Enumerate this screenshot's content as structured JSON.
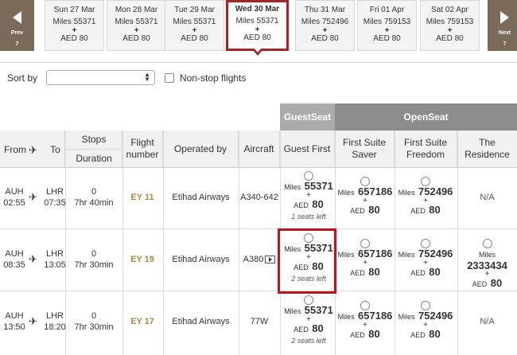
{
  "nav": {
    "prev_label": "Prev",
    "prev_num": "7",
    "next_label": "Next",
    "next_num": "7"
  },
  "dates": [
    {
      "date": "Sun 27 Mar",
      "miles": "Miles 55371",
      "plus": "+",
      "aed": "AED 80"
    },
    {
      "date": "Mon 28 Mar",
      "miles": "Miles 55371",
      "plus": "+",
      "aed": "AED 80"
    },
    {
      "date": "Tue 29 Mar",
      "miles": "Miles 55371",
      "plus": "+",
      "aed": "AED 80"
    },
    {
      "date": "Wed 30 Mar",
      "miles": "Miles 55371",
      "plus": "+",
      "aed": "AED 80"
    },
    {
      "date": "Thu 31 Mar",
      "miles": "Miles 752496",
      "plus": "+",
      "aed": "AED 80"
    },
    {
      "date": "Fri 01 Apr",
      "miles": "Miles 759153",
      "plus": "+",
      "aed": "AED 80"
    },
    {
      "date": "Sat 02 Apr",
      "miles": "Miles 759153",
      "plus": "+",
      "aed": "AED 80"
    }
  ],
  "selected_date_index": 3,
  "sort": {
    "label": "Sort by",
    "value": "",
    "nonstop_label": "Non-stop flights",
    "nonstop_checked": false
  },
  "bands": {
    "guestseat": "GuestSeat",
    "openseat": "OpenSeat"
  },
  "headers": {
    "from": "From",
    "to": "To",
    "stops": "Stops",
    "duration": "Duration",
    "flight_1": "Flight",
    "flight_2": "number",
    "operated_by": "Operated by",
    "aircraft": "Aircraft",
    "guest_first": "Guest First",
    "suite_saver_1": "First Suite",
    "suite_saver_2": "Saver",
    "suite_freedom_1": "First Suite",
    "suite_freedom_2": "Freedom",
    "residence_1": "The",
    "residence_2": "Residence"
  },
  "rows": [
    {
      "dep_code": "AUH",
      "dep_time": "02:55",
      "arr_code": "LHR",
      "arr_time": "07:35",
      "stops": "0",
      "duration": "7hr 40min",
      "flight": "EY 11",
      "operator": "Etihad Airways",
      "aircraft": "A340-642",
      "guest": {
        "miles_label": "Miles",
        "miles": "55371",
        "plus": "+",
        "aed_label": "AED",
        "aed": "80",
        "seats": "1 seats left"
      },
      "saver": {
        "miles_label": "Miles",
        "miles": "657186",
        "plus": "+",
        "aed_label": "AED",
        "aed": "80"
      },
      "freedom": {
        "miles_label": "Miles",
        "miles": "752496",
        "plus": "+",
        "aed_label": "AED",
        "aed": "80"
      },
      "residence_na": "N/A"
    },
    {
      "dep_code": "AUH",
      "dep_time": "08:35",
      "arr_code": "LHR",
      "arr_time": "13:05",
      "stops": "0",
      "duration": "7hr 30min",
      "flight": "EY 19",
      "operator": "Etihad Airways",
      "aircraft": "A380",
      "guest": {
        "miles_label": "Miles",
        "miles": "55371",
        "plus": "+",
        "aed_label": "AED",
        "aed": "80",
        "seats": "2 seats left"
      },
      "saver": {
        "miles_label": "Miles",
        "miles": "657186",
        "plus": "+",
        "aed_label": "AED",
        "aed": "80"
      },
      "freedom": {
        "miles_label": "Miles",
        "miles": "752496",
        "plus": "+",
        "aed_label": "AED",
        "aed": "80"
      },
      "residence": {
        "miles_label": "Miles",
        "miles": "2333434",
        "plus": "+",
        "aed_label": "AED",
        "aed": "80"
      }
    },
    {
      "dep_code": "AUH",
      "dep_time": "13:50",
      "arr_code": "LHR",
      "arr_time": "18:20",
      "stops": "0",
      "duration": "7hr 30min",
      "flight": "EY 17",
      "operator": "Etihad Airways",
      "aircraft": "77W",
      "guest": {
        "miles_label": "Miles",
        "miles": "55371",
        "plus": "+",
        "aed_label": "AED",
        "aed": "80",
        "seats": "2 seats left"
      },
      "saver": {
        "miles_label": "Miles",
        "miles": "657186",
        "plus": "+",
        "aed_label": "AED",
        "aed": "80"
      },
      "freedom": {
        "miles_label": "Miles",
        "miles": "752496",
        "plus": "+",
        "aed_label": "AED",
        "aed": "80"
      },
      "residence_na": "N/A"
    }
  ],
  "colors": {
    "brand_red": "#a3262a",
    "highlight_red": "#c0141d",
    "flight_gold": "#b08a3b",
    "guestseat_band": "#ababab",
    "openseat_band": "#8c8c8c",
    "nav_brown": "#7a6a5a"
  }
}
